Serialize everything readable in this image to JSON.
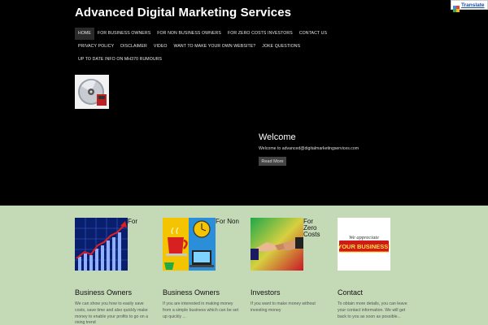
{
  "site": {
    "title": "Advanced Digital Marketing Services"
  },
  "translate": {
    "label": "Translate"
  },
  "nav": {
    "row1": [
      "HOME",
      "FOR BUSINESS OWNERS",
      "FOR NON BUSINESS OWNERS",
      "FOR ZERO COSTS INVESTORS",
      "CONTACT US"
    ],
    "row2": [
      "PRIVACY POLICY",
      "DISCLAIMER",
      "VIDEO",
      "WANT TO MAKE YOUR OWN WEBSITE?",
      "JOKE QUESTIONS"
    ],
    "row3": [
      "UP TO DATE INFO ON MH370 RUMOURS"
    ]
  },
  "welcome": {
    "title": "Welcome",
    "text": "Welcome to advanced@digitalmarketingservices.com",
    "button": "Read More"
  },
  "columns": [
    {
      "side_label": "For",
      "title": "Business Owners",
      "text": "We can show you how to easily save costs, save time and also quickly make money to enable your profits to go on a rising trend"
    },
    {
      "side_label": "For Non",
      "title": "Business Owners",
      "text": "If you are interested in making money from a simple business which can be set up quickly ..."
    },
    {
      "side_label": "For Zero Costs",
      "title": "Investors",
      "text": "If you want to make money without investing money"
    },
    {
      "side_label": "",
      "title": "Contact",
      "text": "To obtain more details, you can leave your contact information. We will get back to you as soon as possible..."
    }
  ],
  "contact_image": {
    "line1": "We appreciate",
    "line2": "YOUR BUSINESS!"
  },
  "colors": {
    "header_bg": "#000000",
    "content_bg": "#c4d9b6",
    "translate_link": "#1a4fa0"
  },
  "icons": [
    "google-translate-icon",
    "cd-disc-icon",
    "chart-icon",
    "coffee-clock-icon",
    "handshake-icon",
    "appreciate-banner-icon"
  ]
}
